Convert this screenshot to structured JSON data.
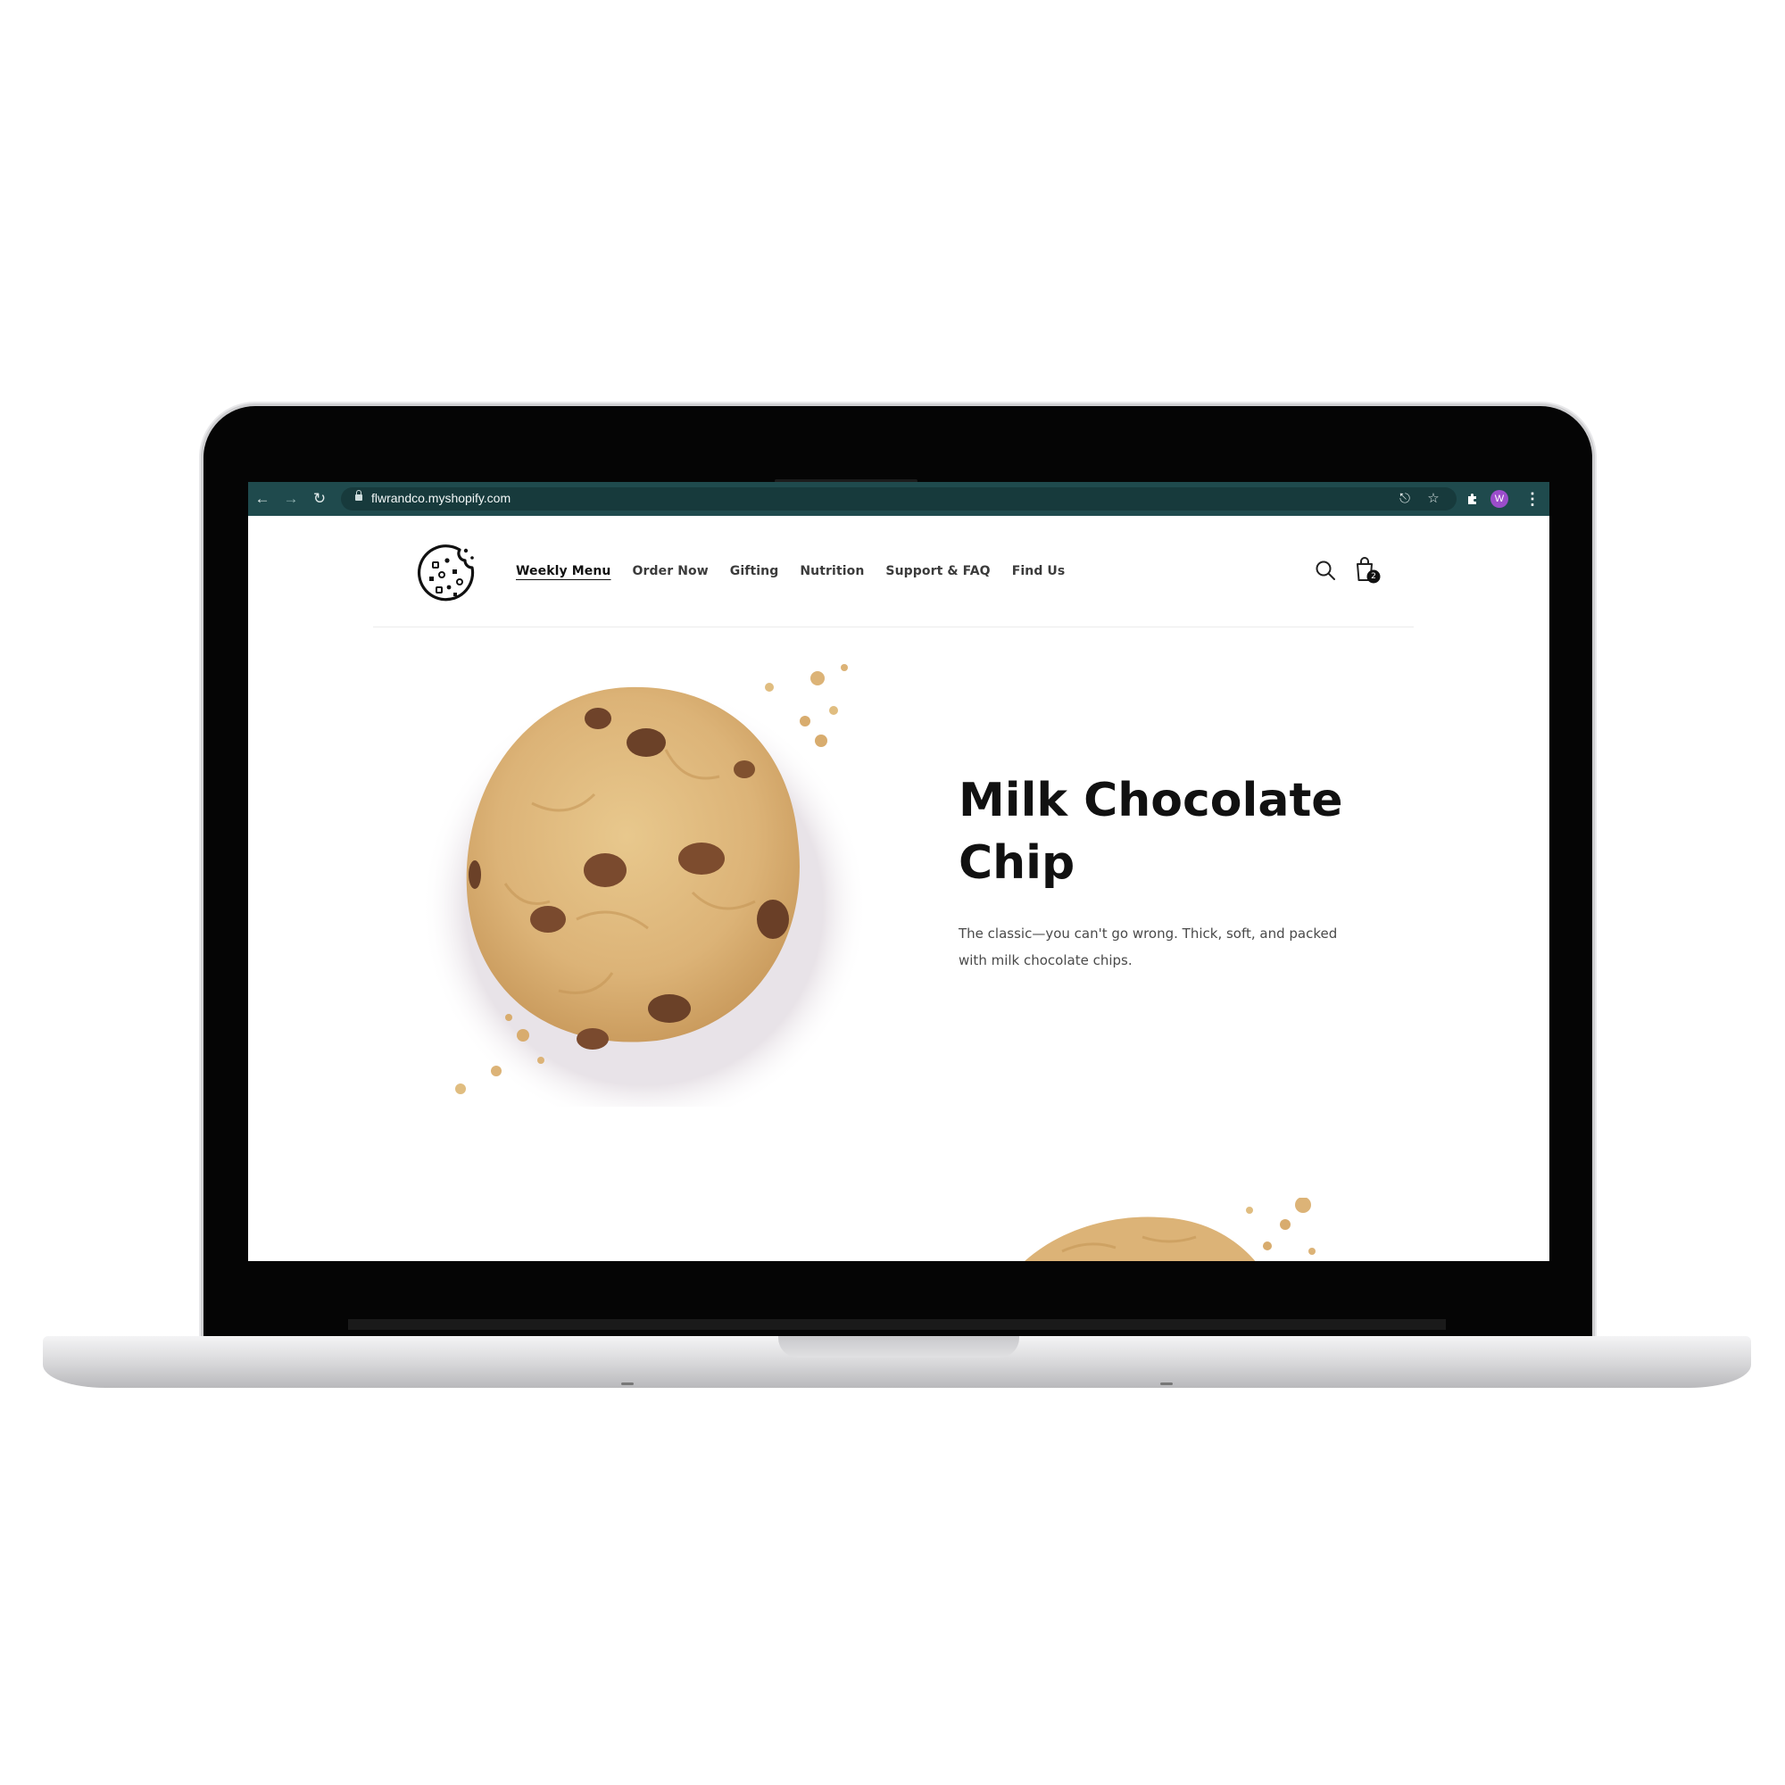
{
  "browser": {
    "url": "flwrandco.myshopify.com",
    "profile_initial": "W",
    "colors": {
      "toolbar": "#1f4a4d",
      "omnibox": "#173a3c",
      "profile": "#9b4dcb"
    }
  },
  "header": {
    "nav": [
      {
        "label": "Weekly Menu",
        "active": true
      },
      {
        "label": "Order Now"
      },
      {
        "label": "Gifting"
      },
      {
        "label": "Nutrition"
      },
      {
        "label": "Support & FAQ"
      },
      {
        "label": "Find Us"
      }
    ],
    "cart_count": "2"
  },
  "hero": {
    "title": "Milk Chocolate Chip",
    "description": "The classic—you can't go wrong. Thick, soft, and packed with milk chocolate chips."
  },
  "icons": [
    "back-arrow-icon",
    "forward-arrow-icon",
    "reload-icon",
    "lock-icon",
    "share-icon",
    "bookmark-star-icon",
    "extensions-puzzle-icon",
    "more-vertical-icon",
    "cookie-logo-icon",
    "search-icon",
    "cart-bag-icon"
  ]
}
